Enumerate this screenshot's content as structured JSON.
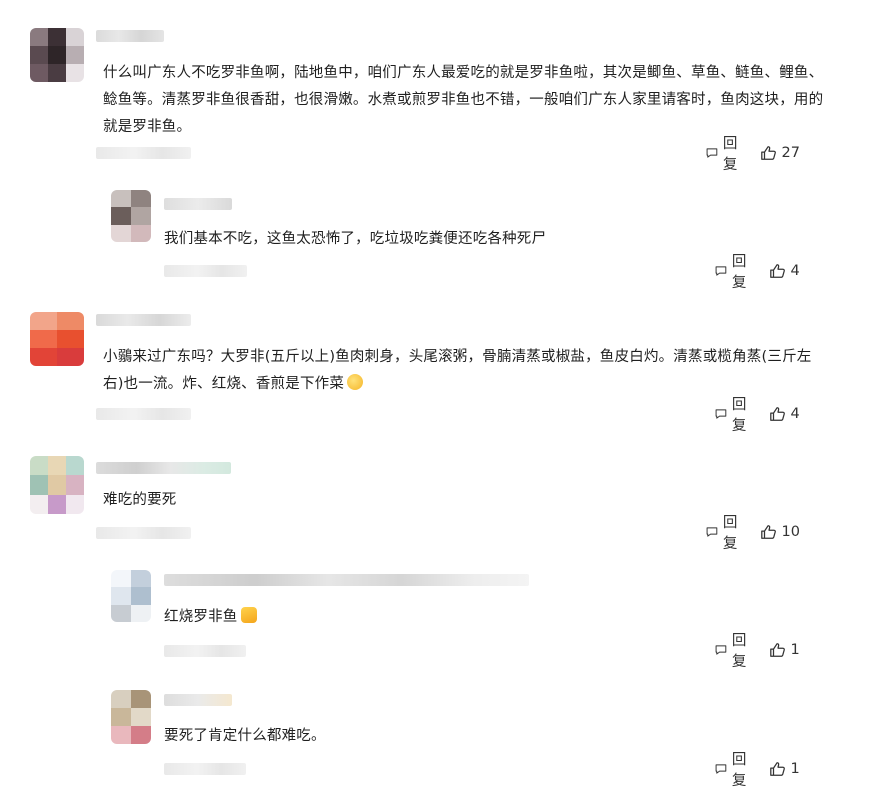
{
  "comments": [
    {
      "text": "什么叫广东人不吃罗非鱼啊，陆地鱼中，咱们广东人最爱吃的就是罗非鱼啦，其次是鲫鱼、草鱼、鲢鱼、鲤鱼、鲶鱼等。清蒸罗非鱼很香甜，也很滑嫩。水煮或煎罗非鱼也不错，一般咱们广东人家里请客时，鱼肉这块，用的就是罗非鱼。",
      "reply_label": "回复",
      "likes": "27"
    },
    {
      "text": "我们基本不吃，这鱼太恐怖了，吃垃圾吃粪便还吃各种死尸",
      "reply_label": "回复",
      "likes": "4"
    },
    {
      "text": "小鶸来过广东吗？大罗非(五斤以上)鱼肉刺身，头尾滚粥，骨腩清蒸或椒盐，鱼皮白灼。清蒸或榄角蒸(三斤左右)也一流。炸、红烧、香煎是下作菜",
      "reply_label": "回复",
      "likes": "4"
    },
    {
      "text": "难吃的要死",
      "reply_label": "回复",
      "likes": "10"
    },
    {
      "text": "红烧罗非鱼",
      "reply_label": "回复",
      "likes": "1"
    },
    {
      "text": "要死了肯定什么都难吃。",
      "reply_label": "回复",
      "likes": "1"
    }
  ],
  "icons": {
    "reply": "comment-bubble-icon",
    "like": "thumbs-up-icon"
  }
}
